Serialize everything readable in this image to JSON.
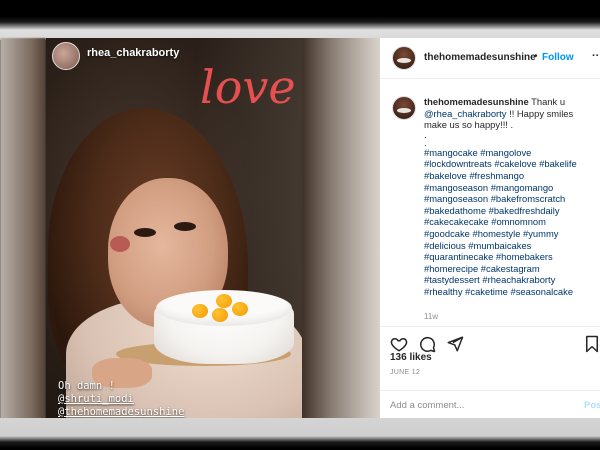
{
  "story": {
    "username": "rhea_chakraborty",
    "sticker_text": "love",
    "caption_lines": [
      "Oh damn !",
      "@shruti_modi",
      "@thehomemadesunshine"
    ]
  },
  "post": {
    "header": {
      "username": "thehomemadesunshine",
      "separator": "•",
      "follow_label": "Follow",
      "more_label": "···"
    },
    "caption": {
      "username": "thehomemadesunshine",
      "text_before": "Thank u",
      "mention": "@rhea_chakraborty",
      "text_after": "!! Happy smiles make us so happy!!! .",
      "dots": [
        ".",
        "."
      ],
      "hashtags": [
        "#mangocake #mangolove",
        "#lockdowntreats #cakelove #bakelife",
        "#bakelove #freshmango",
        "#mangoseason #mangomango",
        "#mangoseason #bakefromscratch",
        "#bakedathome #bakedfreshdaily",
        "#cakecakecake #omnomnom",
        "#goodcake #homestyle #yummy",
        "#delicious #mumbaicakes",
        "#quarantinecake #homebakers",
        "#homerecipe #cakestagram",
        "#tastydessert #rheachakraborty",
        "#rhealthy #caketime #seasonalcake"
      ],
      "time_ago": "11w"
    },
    "likes": "136 likes",
    "date": "JUNE 12",
    "comment_placeholder": "Add a comment...",
    "post_label": "Post"
  },
  "icons": {
    "like": "heart-icon",
    "comment": "comment-icon",
    "share": "send-icon",
    "save": "bookmark-icon"
  }
}
